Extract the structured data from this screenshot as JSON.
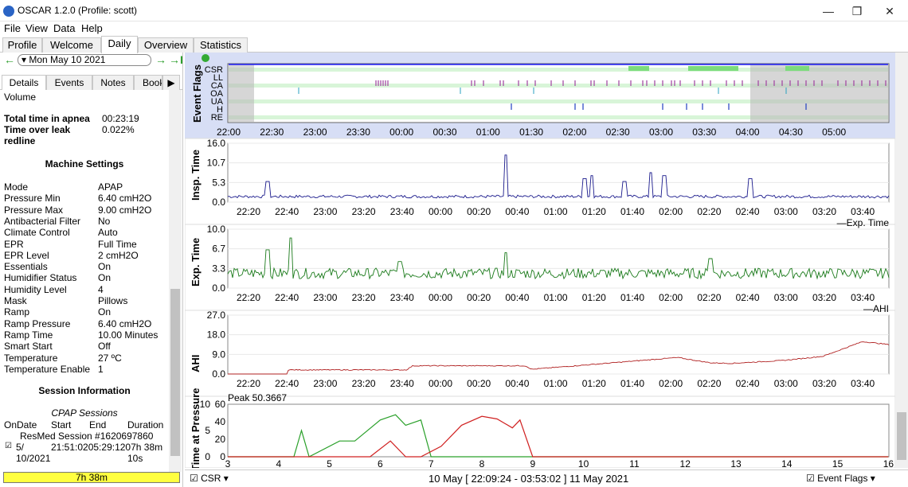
{
  "window": {
    "title": "OSCAR 1.2.0 (Profile: scott)",
    "minimize": "—",
    "restore": "❐",
    "close": "✕"
  },
  "menu": [
    "File",
    "View",
    "Data",
    "Help"
  ],
  "tabs": [
    "Profile",
    "Welcome",
    "Daily",
    "Overview",
    "Statistics"
  ],
  "date_nav": {
    "back": "←",
    "forward": "→",
    "last": "→I",
    "date": "Mon May 10 2021"
  },
  "subtabs": [
    "Details",
    "Events",
    "Notes",
    "Book",
    "▶"
  ],
  "details": {
    "volume_label": "Volume",
    "apnea_label": "Total time in apnea",
    "apnea_value": "00:23:19",
    "leak_label": "Time over leak",
    "leak_label2": "redline",
    "leak_value": "0.022%",
    "machine_header": "Machine Settings",
    "settings": [
      [
        "Mode",
        "APAP"
      ],
      [
        "Pressure Min",
        "6.40 cmH2O"
      ],
      [
        "Pressure Max",
        "9.00 cmH2O"
      ],
      [
        "Antibacterial Filter",
        "No"
      ],
      [
        "Climate Control",
        "Auto"
      ],
      [
        "EPR",
        "Full Time"
      ],
      [
        "EPR Level",
        "2 cmH2O"
      ],
      [
        "Essentials",
        "On"
      ],
      [
        "Humidifier Status",
        "On"
      ],
      [
        "Humidity Level",
        "4"
      ],
      [
        "Mask",
        "Pillows"
      ],
      [
        "Ramp",
        "On"
      ],
      [
        "Ramp Pressure",
        "6.40 cmH2O"
      ],
      [
        "Ramp Time",
        "10.00 Minutes"
      ],
      [
        "Smart Start",
        "Off"
      ],
      [
        "Temperature",
        "27 ºC"
      ],
      [
        "Temperature Enable",
        "1"
      ]
    ],
    "session_header": "Session Information",
    "cpap_sessions": "CPAP Sessions",
    "session_cols": [
      "OnDate",
      "Start",
      "End",
      "Duration"
    ],
    "session_name": "ResMed Session #1620697860",
    "session_date1": "5/",
    "session_date2": "10/2021",
    "session_times": "21:51:0205:29:1207h 38m",
    "session_secs": "10s",
    "total_duration": "7h 38m"
  },
  "charts": {
    "event_flags": {
      "title": "Event Flags",
      "rows": [
        "CSR",
        "LL",
        "CA",
        "OA",
        "UA",
        "H",
        "RE"
      ],
      "ticks": [
        "22:00",
        "22:30",
        "23:00",
        "23:30",
        "00:00",
        "00:30",
        "01:00",
        "01:30",
        "02:00",
        "02:30",
        "03:00",
        "03:30",
        "04:00",
        "04:30",
        "05:00"
      ]
    },
    "time_ticks": [
      "22:20",
      "22:40",
      "23:00",
      "23:20",
      "23:40",
      "00:00",
      "00:20",
      "00:40",
      "01:00",
      "01:20",
      "01:40",
      "02:00",
      "02:20",
      "02:40",
      "03:00",
      "03:20",
      "03:40"
    ],
    "insp": {
      "title": "Insp. Time",
      "yticks": [
        "16.0",
        "10.7",
        "5.3",
        "0.0"
      ]
    },
    "exp": {
      "title": "Exp. Time",
      "legend": "Exp. Time",
      "yticks": [
        "10.0",
        "6.7",
        "3.3",
        "0.0"
      ]
    },
    "ahi": {
      "title": "AHI",
      "legend": "AHI",
      "yticks": [
        "27.0",
        "18.0",
        "9.0",
        "0.0"
      ]
    },
    "pressure": {
      "title": "Time at Pressure",
      "peak": "Peak 50.3667",
      "yticks_left": [
        "10",
        "5",
        "0"
      ],
      "yticks_right": [
        "60",
        "40",
        "20",
        "0"
      ],
      "xticks": [
        "3",
        "4",
        "5",
        "6",
        "7",
        "8",
        "9",
        "10",
        "11",
        "12",
        "13",
        "14",
        "15",
        "16"
      ]
    }
  },
  "bottom": {
    "csr": "CSR",
    "range": "10 May [ 22:09:24 - 03:53:02 ] 11 May 2021",
    "event_flags": "Event Flags"
  },
  "colors": {
    "insp": "#1a1a8c",
    "exp": "#1a7a1a",
    "ahi": "#b02020",
    "csr": "#7cdc7c",
    "ca": "#a040a0"
  }
}
